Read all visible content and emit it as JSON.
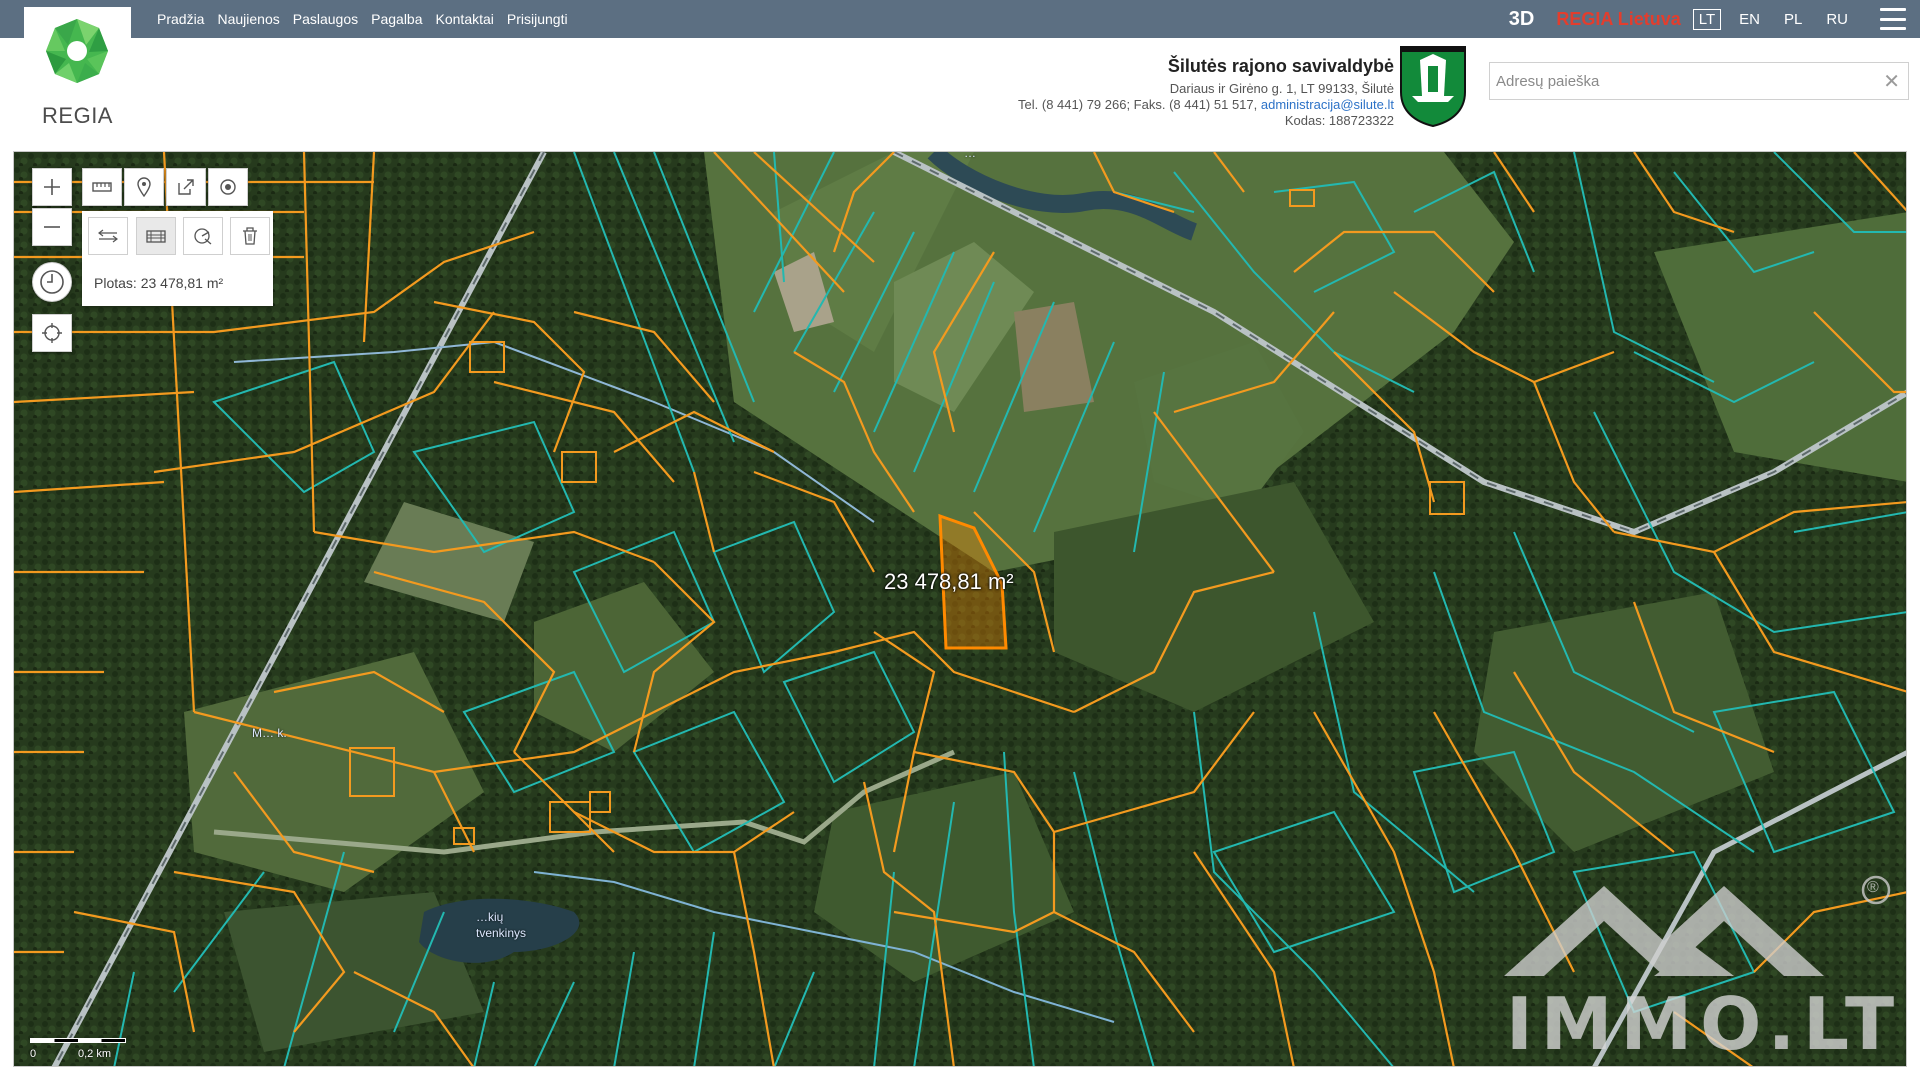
{
  "nav": {
    "items": [
      "Pradžia",
      "Naujienos",
      "Paslaugos",
      "Pagalba",
      "Kontaktai",
      "Prisijungti"
    ]
  },
  "topright": {
    "btn_3d": "3D",
    "regia_lietuva": "REGIA Lietuva",
    "languages": [
      "LT",
      "EN",
      "PL",
      "RU"
    ],
    "active_language": "LT"
  },
  "header": {
    "logo_text": "REGIA",
    "municipality_name": "Šilutės rajono savivaldybė",
    "address": "Dariaus ir Girėno g. 1, LT 99133, Šilutė",
    "contacts": "Tel. (8 441) 79 266; Faks. (8 441) 51 517, ",
    "email": "administracija@silute.lt",
    "code": "Kodas: 188723322"
  },
  "search": {
    "placeholder": "Adresų paieška",
    "value": ""
  },
  "map": {
    "measure_area_text": "Plotas: 23 478,81 m²",
    "parcel_label": "23 478,81 m²",
    "place_label_1": "M… k.",
    "place_label_2": "…kių",
    "place_label_3": "tvenkinys",
    "place_label_4": "…",
    "scale_min": "0",
    "scale_max": "0,2 km",
    "watermark": "IMMO.LT",
    "watermark_mark": "®"
  },
  "colors": {
    "topbar": "#5c6f82",
    "regia_red": "#e33d2d",
    "parcel_orange": "#f39a1f",
    "parcel_teal": "#23b8b0",
    "selected_parcel": "#ff8a00"
  }
}
